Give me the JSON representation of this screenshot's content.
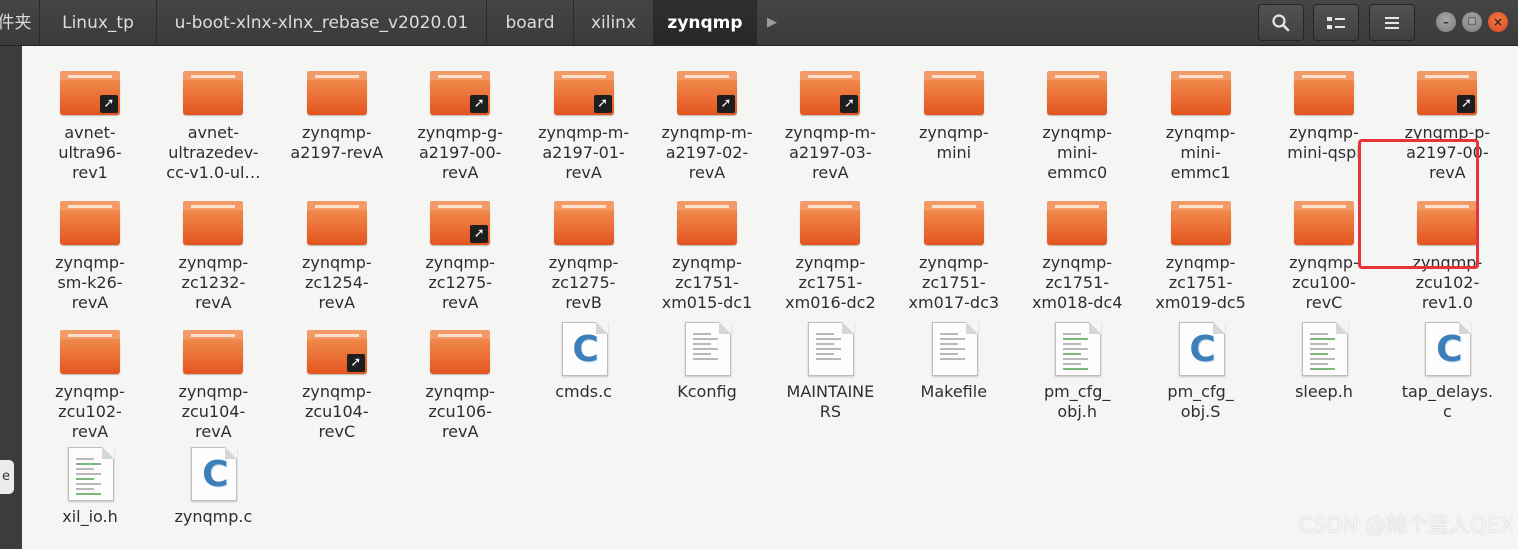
{
  "breadcrumb": [
    {
      "label": "件夹",
      "active": false
    },
    {
      "label": "Linux_tp",
      "active": false
    },
    {
      "label": "u-boot-xlnx-xlnx_rebase_v2020.01",
      "active": false
    },
    {
      "label": "board",
      "active": false
    },
    {
      "label": "xilinx",
      "active": false
    },
    {
      "label": "zynqmp",
      "active": true
    }
  ],
  "breadcrumb_more_icon": "chevron-right",
  "toolbar": {
    "search_icon": "search",
    "view_icon": "list-view",
    "menu_icon": "hamburger-menu"
  },
  "window_controls": {
    "minimize": "–",
    "maximize": "□",
    "close": "×"
  },
  "left_tab_label": "e",
  "files": [
    {
      "name": "avnet-ultra96-rev1",
      "label": "avnet-\nultra96-\nrev1",
      "type": "folder",
      "link": true
    },
    {
      "name": "avnet-ultrazedev-cc-v1.0-ul…",
      "label": "avnet-\nultrazedev-\ncc-v1.0-ul…",
      "type": "folder",
      "link": false
    },
    {
      "name": "zynqmp-a2197-revA",
      "label": "zynqmp-\na2197-revA",
      "type": "folder",
      "link": false
    },
    {
      "name": "zynqmp-g-a2197-00-revA",
      "label": "zynqmp-g-\na2197-00-\nrevA",
      "type": "folder",
      "link": true
    },
    {
      "name": "zynqmp-m-a2197-01-revA",
      "label": "zynqmp-m-\na2197-01-\nrevA",
      "type": "folder",
      "link": true
    },
    {
      "name": "zynqmp-m-a2197-02-revA",
      "label": "zynqmp-m-\na2197-02-\nrevA",
      "type": "folder",
      "link": true
    },
    {
      "name": "zynqmp-m-a2197-03-revA",
      "label": "zynqmp-m-\na2197-03-\nrevA",
      "type": "folder",
      "link": true
    },
    {
      "name": "zynqmp-mini",
      "label": "zynqmp-\nmini",
      "type": "folder",
      "link": false
    },
    {
      "name": "zynqmp-mini-emmc0",
      "label": "zynqmp-\nmini-\nemmc0",
      "type": "folder",
      "link": false
    },
    {
      "name": "zynqmp-mini-emmc1",
      "label": "zynqmp-\nmini-\nemmc1",
      "type": "folder",
      "link": false
    },
    {
      "name": "zynqmp-mini-qspi",
      "label": "zynqmp-\nmini-qspi",
      "type": "folder",
      "link": false
    },
    {
      "name": "zynqmp-p-a2197-00-revA",
      "label": "zynqmp-p-\na2197-00-\nrevA",
      "type": "folder",
      "link": true
    },
    {
      "name": "zynqmp-sm-k26-revA",
      "label": "zynqmp-\nsm-k26-\nrevA",
      "type": "folder",
      "link": false
    },
    {
      "name": "zynqmp-zc1232-revA",
      "label": "zynqmp-\nzc1232-\nrevA",
      "type": "folder",
      "link": false
    },
    {
      "name": "zynqmp-zc1254-revA",
      "label": "zynqmp-\nzc1254-\nrevA",
      "type": "folder",
      "link": false
    },
    {
      "name": "zynqmp-zc1275-revA",
      "label": "zynqmp-\nzc1275-\nrevA",
      "type": "folder",
      "link": true
    },
    {
      "name": "zynqmp-zc1275-revB",
      "label": "zynqmp-\nzc1275-\nrevB",
      "type": "folder",
      "link": false
    },
    {
      "name": "zynqmp-zc1751-xm015-dc1",
      "label": "zynqmp-\nzc1751-\nxm015-dc1",
      "type": "folder",
      "link": false
    },
    {
      "name": "zynqmp-zc1751-xm016-dc2",
      "label": "zynqmp-\nzc1751-\nxm016-dc2",
      "type": "folder",
      "link": false
    },
    {
      "name": "zynqmp-zc1751-xm017-dc3",
      "label": "zynqmp-\nzc1751-\nxm017-dc3",
      "type": "folder",
      "link": false
    },
    {
      "name": "zynqmp-zc1751-xm018-dc4",
      "label": "zynqmp-\nzc1751-\nxm018-dc4",
      "type": "folder",
      "link": false
    },
    {
      "name": "zynqmp-zc1751-xm019-dc5",
      "label": "zynqmp-\nzc1751-\nxm019-dc5",
      "type": "folder",
      "link": false
    },
    {
      "name": "zynqmp-zcu100-revC",
      "label": "zynqmp-\nzcu100-\nrevC",
      "type": "folder",
      "link": false
    },
    {
      "name": "zynqmp-zcu102-rev1.0",
      "label": "zynqmp-\nzcu102-\nrev1.0",
      "type": "folder",
      "link": false,
      "highlighted": true
    },
    {
      "name": "zynqmp-zcu102-revA",
      "label": "zynqmp-\nzcu102-\nrevA",
      "type": "folder",
      "link": false
    },
    {
      "name": "zynqmp-zcu104-revA",
      "label": "zynqmp-\nzcu104-\nrevA",
      "type": "folder",
      "link": false
    },
    {
      "name": "zynqmp-zcu104-revC",
      "label": "zynqmp-\nzcu104-\nrevC",
      "type": "folder",
      "link": true
    },
    {
      "name": "zynqmp-zcu106-revA",
      "label": "zynqmp-\nzcu106-\nrevA",
      "type": "folder",
      "link": false
    },
    {
      "name": "cmds.c",
      "label": "cmds.c",
      "type": "c-source"
    },
    {
      "name": "Kconfig",
      "label": "Kconfig",
      "type": "text"
    },
    {
      "name": "MAINTAINERS",
      "label": "MAINTAINE\nRS",
      "type": "text"
    },
    {
      "name": "Makefile",
      "label": "Makefile",
      "type": "text"
    },
    {
      "name": "pm_cfg_obj.h",
      "label": "pm_cfg_\nobj.h",
      "type": "header"
    },
    {
      "name": "pm_cfg_obj.S",
      "label": "pm_cfg_\nobj.S",
      "type": "c-source"
    },
    {
      "name": "sleep.h",
      "label": "sleep.h",
      "type": "header"
    },
    {
      "name": "tap_delays.c",
      "label": "tap_delays.\nc",
      "type": "c-source"
    },
    {
      "name": "xil_io.h",
      "label": "xil_io.h",
      "type": "header"
    },
    {
      "name": "zynqmp.c",
      "label": "zynqmp.c",
      "type": "c-source"
    }
  ],
  "colors": {
    "folder": "#e4541f",
    "highlight": "#e5343b",
    "c_icon": "#3d7fb8"
  },
  "watermark": "CSDN @辣个蓝人QEX"
}
